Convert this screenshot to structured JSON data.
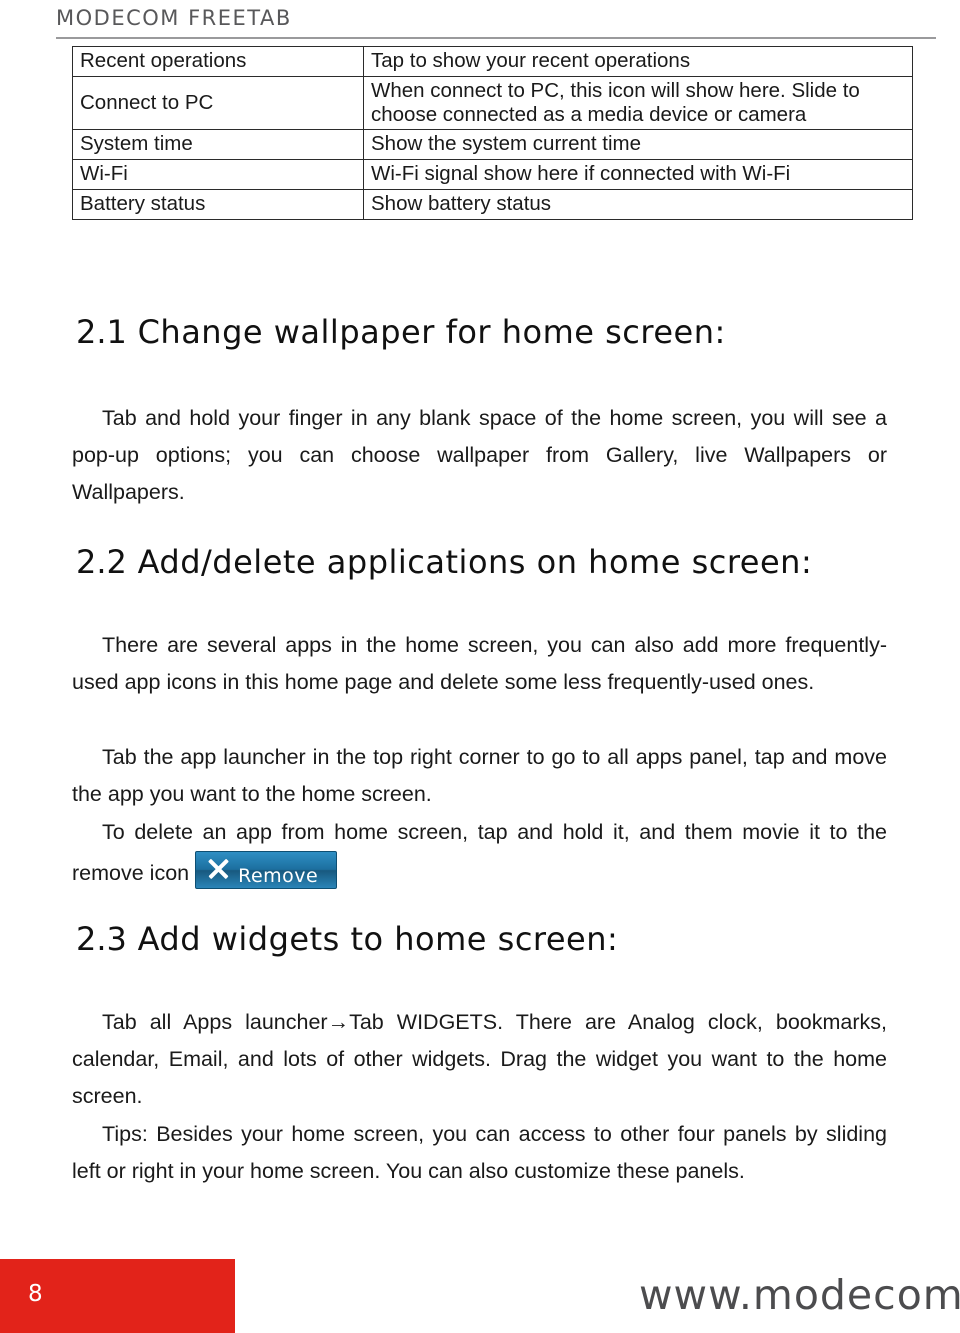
{
  "header": {
    "brand": "MODECOM FREETAB"
  },
  "status_table": {
    "rows": [
      {
        "label": "Recent operations",
        "desc": "Tap to show your recent operations"
      },
      {
        "label": "Connect to PC",
        "desc": "When connect to PC, this icon will show here. Slide to choose connected as a media device or camera"
      },
      {
        "label": "System time",
        "desc": "Show the system current time"
      },
      {
        "label": "Wi-Fi",
        "desc": "Wi-Fi signal show here if connected with Wi-Fi"
      },
      {
        "label": "Battery status",
        "desc": "Show battery status"
      }
    ]
  },
  "sections": [
    {
      "number": "2.1",
      "title": "Change wallpaper for home screen:",
      "paragraphs": [
        "Tab and hold your finger in any blank space of the home screen, you will see a pop-up options; you can choose wallpaper from Gallery, live Wallpapers or Wallpapers."
      ]
    },
    {
      "number": "2.2",
      "title": "Add/delete applications on home screen:",
      "paragraphs": [
        "There are several apps in the home screen, you can also add more frequently-used app icons in this home page and delete some less frequently-used ones.",
        "Tab the app launcher in the top right corner to go to all apps panel, tap and move the app you want to the home screen.",
        "To delete an app from home screen, tap and hold it, and them movie it to the remove icon"
      ]
    },
    {
      "number": "2.3",
      "title": "Add widgets to home screen:",
      "paragraphs": [
        "Tab all Apps launcher→Tab WIDGETS. There are Analog clock, bookmarks, calendar, Email, and lots of other widgets. Drag the widget you want to the home screen.",
        "Tips: Besides your home screen, you can access to other four panels by sliding left or right in your home screen. You can also customize these panels."
      ]
    }
  ],
  "remove_icon": {
    "label": "Remove",
    "glyph": "x-icon"
  },
  "footer": {
    "page_number": "8",
    "website": "www.modecom.eu",
    "accent_color": "#e2231a"
  }
}
